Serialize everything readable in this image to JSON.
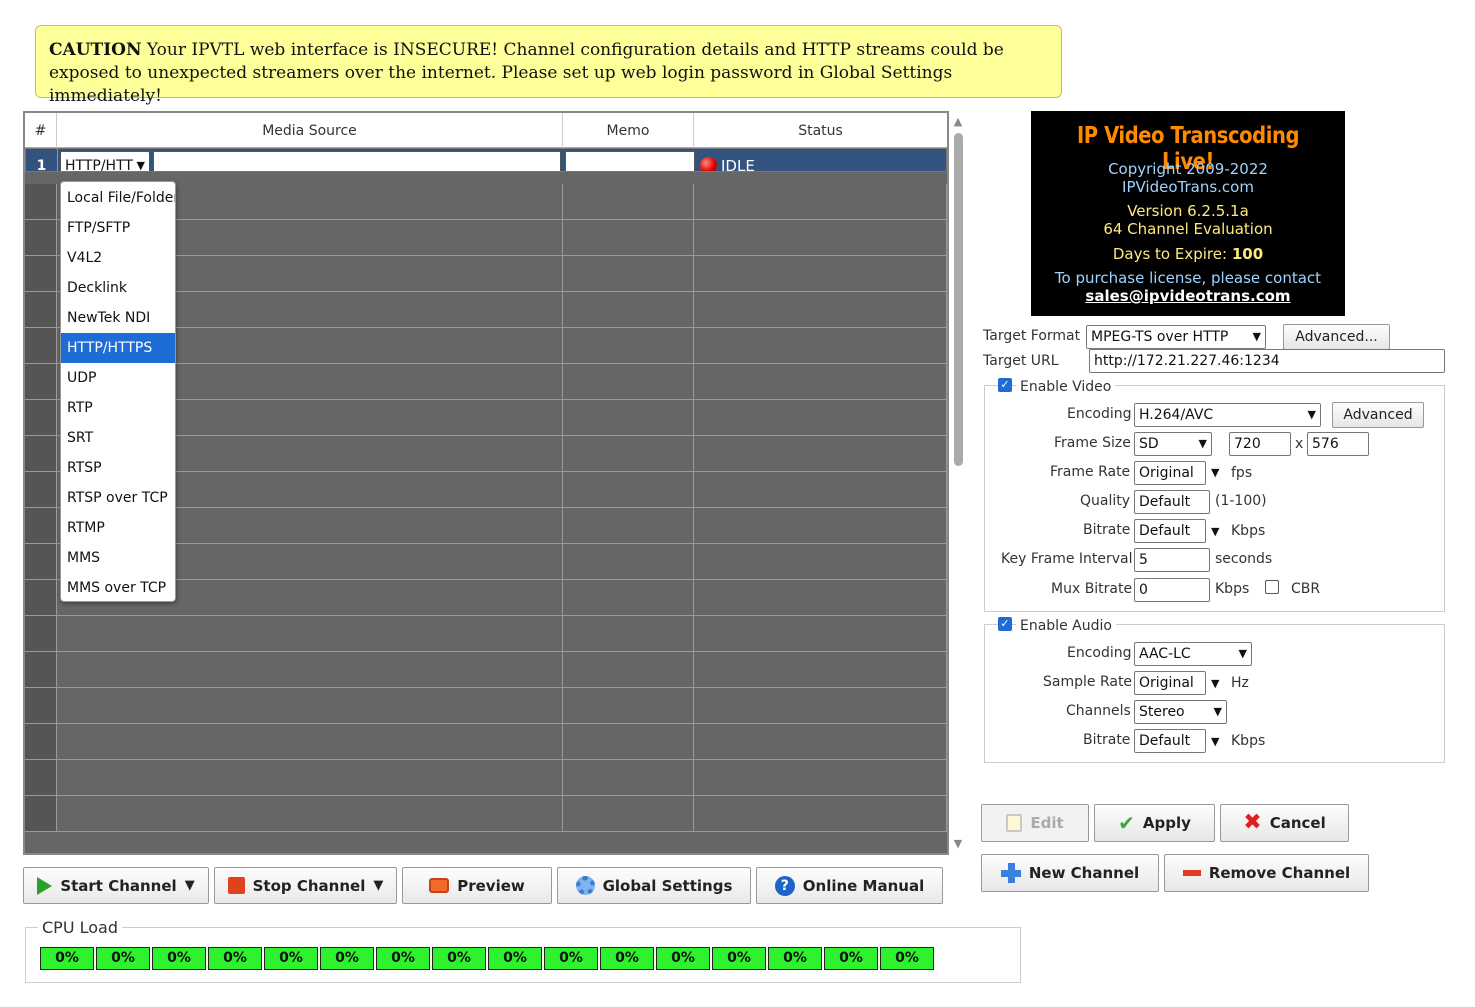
{
  "caution": {
    "label": "CAUTION",
    "text": " Your IPVTL web interface is INSECURE! Channel configuration details and HTTP streams could be exposed to unexpected streamers over the internet. Please set up web login password in Global Settings immediately!"
  },
  "table": {
    "headers": [
      "#",
      "Media Source",
      "Memo",
      "Status"
    ],
    "row1": {
      "num": "1",
      "source_type": "HTTP/HTT",
      "status": "IDLE"
    }
  },
  "source_dropdown": {
    "options": [
      "Local File/Folder",
      "FTP/SFTP",
      "V4L2",
      "Decklink",
      "NewTek NDI",
      "HTTP/HTTPS",
      "UDP",
      "RTP",
      "SRT",
      "RTSP",
      "RTSP over TCP",
      "RTMP",
      "MMS",
      "MMS over TCP"
    ],
    "selected": "HTTP/HTTPS"
  },
  "toolbar": {
    "start": "Start Channel",
    "stop": "Stop Channel",
    "preview": "Preview",
    "global": "Global Settings",
    "manual": "Online Manual"
  },
  "cpu": {
    "title": "CPU Load",
    "cells": [
      "0%",
      "0%",
      "0%",
      "0%",
      "0%",
      "0%",
      "0%",
      "0%",
      "0%",
      "0%",
      "0%",
      "0%",
      "0%",
      "0%",
      "0%",
      "0%"
    ]
  },
  "logo": {
    "title": "IP Video Transcoding Live!",
    "copyright": "Copyright 2009-2022",
    "site": "IPVideoTrans.com",
    "version": "Version 6.2.5.1a",
    "edition": "64 Channel Evaluation",
    "expire_label": "Days to Expire:",
    "expire_value": "100",
    "purchase": "To purchase license, please contact",
    "email": "sales@ipvideotrans.com"
  },
  "target": {
    "format_label": "Target Format",
    "format_value": "MPEG-TS over HTTP",
    "advanced": "Advanced...",
    "url_label": "Target URL",
    "url_value": "http://172.21.227.46:1234"
  },
  "video": {
    "enable_label": "Enable Video",
    "encoding_label": "Encoding",
    "encoding_value": "H.264/AVC",
    "advanced": "Advanced",
    "framesize_label": "Frame Size",
    "framesize_value": "SD",
    "width": "720",
    "x": "x",
    "height": "576",
    "framerate_label": "Frame Rate",
    "framerate_value": "Original",
    "fps": "fps",
    "quality_label": "Quality",
    "quality_value": "Default",
    "quality_range": "(1-100)",
    "bitrate_label": "Bitrate",
    "bitrate_value": "Default",
    "kbps": "Kbps",
    "keyframe_label": "Key Frame Interval",
    "keyframe_value": "5",
    "seconds": "seconds",
    "mux_label": "Mux Bitrate",
    "mux_value": "0",
    "cbr": "CBR"
  },
  "audio": {
    "enable_label": "Enable Audio",
    "encoding_label": "Encoding",
    "encoding_value": "AAC-LC",
    "samplerate_label": "Sample Rate",
    "samplerate_value": "Original",
    "hz": "Hz",
    "channels_label": "Channels",
    "channels_value": "Stereo",
    "bitrate_label": "Bitrate",
    "bitrate_value": "Default",
    "kbps": "Kbps"
  },
  "actions": {
    "edit": "Edit",
    "apply": "Apply",
    "cancel": "Cancel",
    "new_channel": "New Channel",
    "remove_channel": "Remove Channel"
  }
}
